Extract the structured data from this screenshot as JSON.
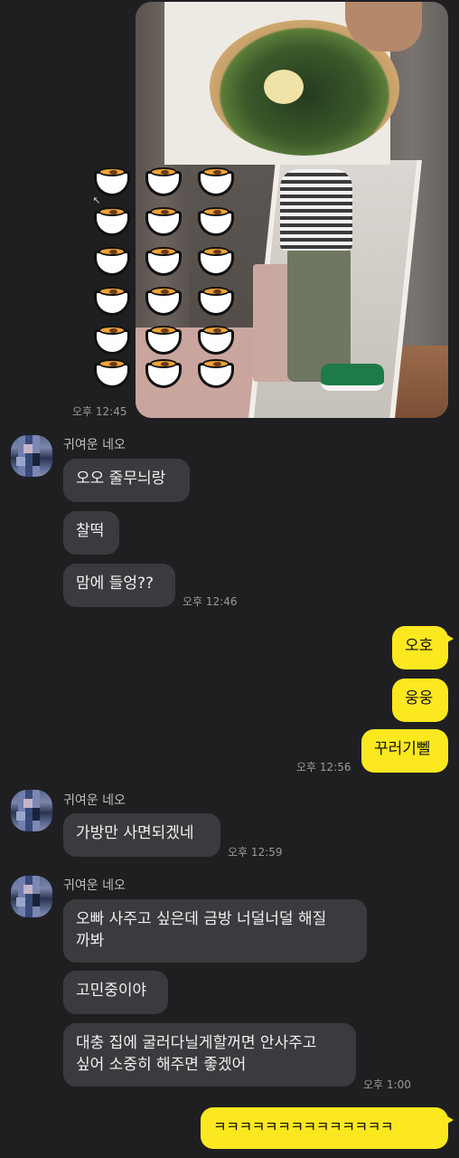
{
  "chat": {
    "photo_time": "오후 12:45",
    "group1": {
      "sender": "귀여운 네오",
      "messages": [
        "오오 줄무늬랑",
        "찰떡",
        "맘에 들엉??"
      ],
      "time": "오후 12:46"
    },
    "mine1": {
      "messages": [
        "오호",
        "웅웅",
        "꾸러기뻴"
      ],
      "time": "오후 12:56"
    },
    "group2": {
      "sender": "귀여운 네오",
      "messages": [
        "가방만 사면되겠네"
      ],
      "time": "오후 12:59"
    },
    "group3": {
      "sender": "귀여운 네오",
      "messages": [
        "오빠 사주고 싶은데 금방 너덜너덜 해질\n까봐",
        "고민중이야",
        "대충 집에 굴러다닐게할꺼면 안사주고\n싶어 소중히 해주면 좋겠어"
      ],
      "time": "오후 1:00"
    },
    "mine2": {
      "messages": [
        "ㅋㅋㅋㅋㅋㅋㅋㅋㅋㅋㅋㅋㅋㅋ"
      ]
    }
  },
  "icons": {
    "emoticon": "curry-bowl-icon",
    "expand": "arrow-icon"
  },
  "colors": {
    "background": "#1f1f22",
    "my_bubble": "#fce81f",
    "their_bubble": "#3b3b3f"
  }
}
